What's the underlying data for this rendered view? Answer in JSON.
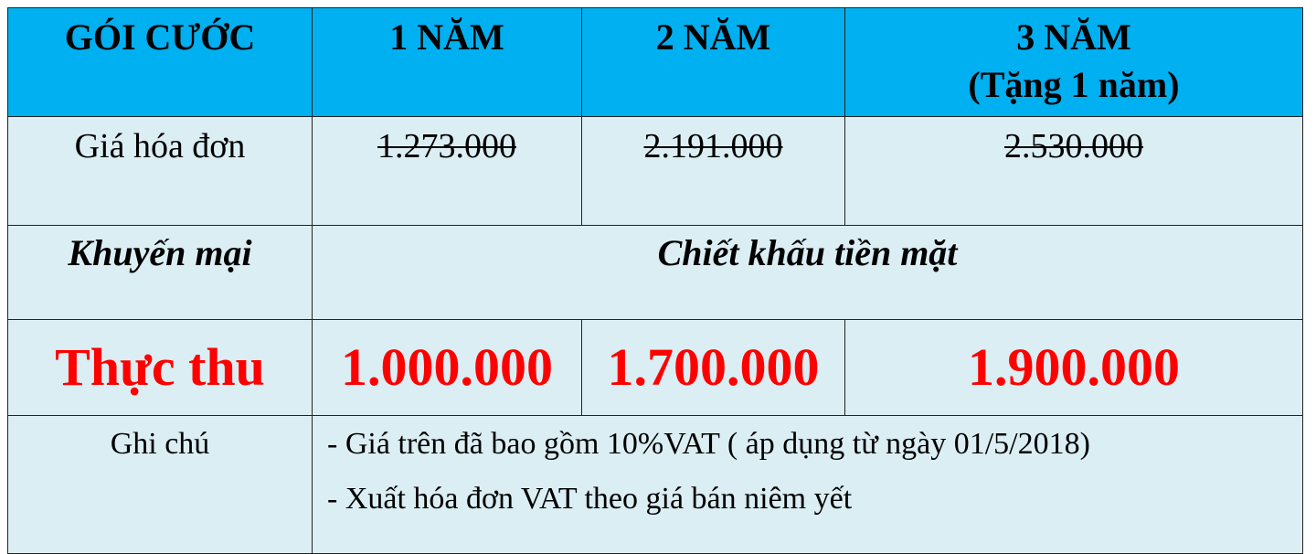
{
  "table": {
    "header": {
      "label": "GÓI CƯỚC",
      "plans": [
        "1 NĂM",
        "2 NĂM"
      ],
      "plan3_line1": "3 NĂM",
      "plan3_line2": "(Tặng 1 năm)"
    },
    "invoice": {
      "label": "Giá hóa đơn",
      "values": [
        "1.273.000",
        "2.191.000",
        "2.530.000"
      ]
    },
    "promotion": {
      "label": "Khuyến mại",
      "value": "Chiết khấu tiền mặt"
    },
    "net": {
      "label": "Thực thu",
      "values": [
        "1.000.000",
        "1.700.000",
        "1.900.000"
      ]
    },
    "notes": {
      "label": "Ghi chú",
      "lines": [
        "- Giá trên đã bao gồm 10%VAT ( áp dụng từ ngày 01/5/2018)",
        "- Xuất hóa đơn VAT theo giá bán niêm yết"
      ]
    }
  },
  "colors": {
    "header_background": "#00b0f0",
    "body_background": "#dbeef4",
    "highlight_text": "#ff0000"
  }
}
